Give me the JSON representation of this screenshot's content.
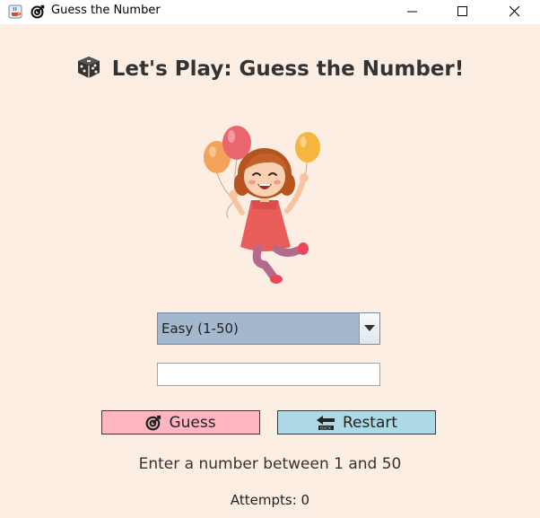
{
  "window": {
    "title": "Guess the Number",
    "title_icons": [
      "java-cup-icon",
      "target-icon"
    ],
    "controls": [
      "minimize-icon",
      "maximize-icon",
      "close-icon"
    ]
  },
  "heading": {
    "icon": "dice-icon",
    "text": "Let's Play: Guess the Number!"
  },
  "illustration": {
    "subject": "girl-with-balloons"
  },
  "difficulty": {
    "selected": "Easy (1-50)"
  },
  "guess_input": {
    "value": "",
    "placeholder": ""
  },
  "buttons": {
    "guess": {
      "label": "Guess",
      "icon": "target-icon",
      "color": "#ffb6c1"
    },
    "restart": {
      "label": "Restart",
      "icon": "back-arrow-icon",
      "color": "#add8e6"
    }
  },
  "hint_text": "Enter a number between 1 and 50",
  "attempts_text": "Attempts: 0",
  "colors": {
    "background": "#fdeee4",
    "combo": "#a3b8cc"
  }
}
